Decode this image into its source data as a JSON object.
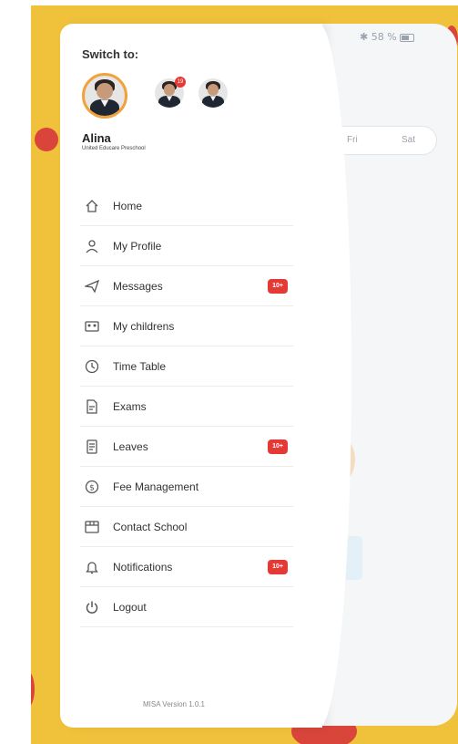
{
  "status_bar": {
    "text": "✱ 58 %"
  },
  "background": {
    "day_fri": "Fri",
    "day_sat": "Sat"
  },
  "drawer": {
    "switch_title": "Switch to:",
    "notification_dot": "19",
    "user": {
      "name": "Alina",
      "school": "United Educare Preschool"
    },
    "menu": [
      {
        "label": "Home",
        "icon": "home-icon"
      },
      {
        "label": "My Profile",
        "icon": "profile-icon"
      },
      {
        "label": "Messages",
        "icon": "messages-icon",
        "badge": "10+"
      },
      {
        "label": "My childrens",
        "icon": "children-icon"
      },
      {
        "label": "Time Table",
        "icon": "clock-icon"
      },
      {
        "label": "Exams",
        "icon": "exams-icon"
      },
      {
        "label": "Leaves",
        "icon": "leaves-icon",
        "badge": "10+"
      },
      {
        "label": "Fee Management",
        "icon": "dollar-icon"
      },
      {
        "label": "Contact School",
        "icon": "contact-icon"
      },
      {
        "label": "Notifications",
        "icon": "bell-icon",
        "badge": "10+"
      },
      {
        "label": "Logout",
        "icon": "power-icon"
      }
    ],
    "version": "MISA Version 1.0.1"
  },
  "colors": {
    "frame": "#f0c23b",
    "accent_dot": "#d9453b",
    "badge": "#e53935"
  }
}
